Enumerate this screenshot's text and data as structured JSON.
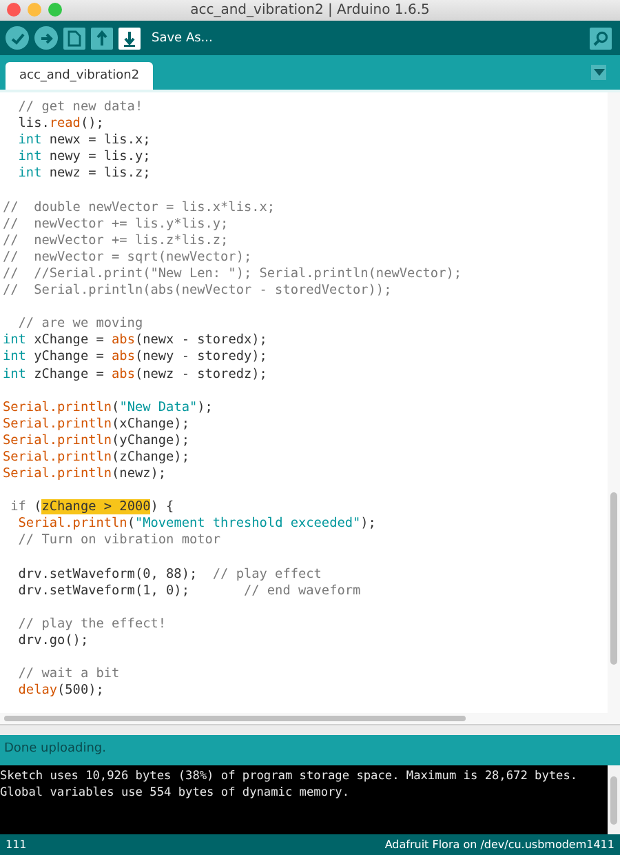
{
  "window": {
    "title": "acc_and_vibration2 | Arduino 1.6.5"
  },
  "toolbar": {
    "buttons": [
      {
        "kind": "verify",
        "highlighted": false
      },
      {
        "kind": "upload",
        "highlighted": false
      },
      {
        "kind": "new",
        "highlighted": false
      },
      {
        "kind": "open",
        "highlighted": false
      },
      {
        "kind": "save",
        "highlighted": true
      }
    ],
    "hint": "Save As..."
  },
  "tabs": [
    {
      "label": "acc_and_vibration2",
      "selected": true
    }
  ],
  "editor": {
    "lines": [
      {
        "kind": "code",
        "tokens": [
          {
            "kind": "comment",
            "text": "  // get new data!"
          }
        ]
      },
      {
        "kind": "code",
        "tokens": [
          {
            "kind": "plain",
            "text": "  lis."
          },
          {
            "kind": "function",
            "text": "read"
          },
          {
            "kind": "plain",
            "text": "();"
          }
        ]
      },
      {
        "kind": "code",
        "tokens": [
          {
            "kind": "keyword",
            "text": "  int"
          },
          {
            "kind": "plain",
            "text": " newx = lis.x;"
          }
        ]
      },
      {
        "kind": "code",
        "tokens": [
          {
            "kind": "keyword",
            "text": "  int"
          },
          {
            "kind": "plain",
            "text": " newy = lis.y;"
          }
        ]
      },
      {
        "kind": "code",
        "tokens": [
          {
            "kind": "keyword",
            "text": "  int"
          },
          {
            "kind": "plain",
            "text": " newz = lis.z;"
          }
        ]
      },
      {
        "kind": "blank"
      },
      {
        "kind": "code",
        "tokens": [
          {
            "kind": "comment",
            "text": "//  double newVector = lis.x*lis.x;"
          }
        ]
      },
      {
        "kind": "code",
        "tokens": [
          {
            "kind": "comment",
            "text": "//  newVector += lis.y*lis.y;"
          }
        ]
      },
      {
        "kind": "code",
        "tokens": [
          {
            "kind": "comment",
            "text": "//  newVector += lis.z*lis.z;"
          }
        ]
      },
      {
        "kind": "code",
        "tokens": [
          {
            "kind": "comment",
            "text": "//  newVector = sqrt(newVector);"
          }
        ]
      },
      {
        "kind": "code",
        "tokens": [
          {
            "kind": "comment",
            "text": "//  //Serial.print(\"New Len: \"); Serial.println(newVector);"
          }
        ]
      },
      {
        "kind": "code",
        "tokens": [
          {
            "kind": "comment",
            "text": "//  Serial.println(abs(newVector - storedVector));"
          }
        ]
      },
      {
        "kind": "blank"
      },
      {
        "kind": "code",
        "tokens": [
          {
            "kind": "comment",
            "text": "  // are we moving"
          }
        ]
      },
      {
        "kind": "code",
        "tokens": [
          {
            "kind": "keyword",
            "text": "int"
          },
          {
            "kind": "plain",
            "text": " xChange = "
          },
          {
            "kind": "function",
            "text": "abs"
          },
          {
            "kind": "plain",
            "text": "(newx - storedx);"
          }
        ]
      },
      {
        "kind": "code",
        "tokens": [
          {
            "kind": "keyword",
            "text": "int"
          },
          {
            "kind": "plain",
            "text": " yChange = "
          },
          {
            "kind": "function",
            "text": "abs"
          },
          {
            "kind": "plain",
            "text": "(newy - storedy);"
          }
        ]
      },
      {
        "kind": "code",
        "tokens": [
          {
            "kind": "keyword",
            "text": "int"
          },
          {
            "kind": "plain",
            "text": " zChange = "
          },
          {
            "kind": "function",
            "text": "abs"
          },
          {
            "kind": "plain",
            "text": "(newz - storedz);"
          }
        ]
      },
      {
        "kind": "blank"
      },
      {
        "kind": "code",
        "tokens": [
          {
            "kind": "function",
            "text": "Serial.println"
          },
          {
            "kind": "plain",
            "text": "("
          },
          {
            "kind": "string",
            "text": "\"New Data\""
          },
          {
            "kind": "plain",
            "text": ");"
          }
        ]
      },
      {
        "kind": "code",
        "tokens": [
          {
            "kind": "function",
            "text": "Serial.println"
          },
          {
            "kind": "plain",
            "text": "(xChange);"
          }
        ]
      },
      {
        "kind": "code",
        "tokens": [
          {
            "kind": "function",
            "text": "Serial.println"
          },
          {
            "kind": "plain",
            "text": "(yChange);"
          }
        ]
      },
      {
        "kind": "code",
        "tokens": [
          {
            "kind": "function",
            "text": "Serial.println"
          },
          {
            "kind": "plain",
            "text": "(zChange);"
          }
        ]
      },
      {
        "kind": "code",
        "tokens": [
          {
            "kind": "function",
            "text": "Serial.println"
          },
          {
            "kind": "plain",
            "text": "(newz);"
          }
        ]
      },
      {
        "kind": "blank"
      },
      {
        "kind": "code",
        "tokens": [
          {
            "kind": "comment",
            "text": " if "
          },
          {
            "kind": "plain",
            "text": "("
          },
          {
            "kind": "highlight",
            "text": "zChange > 2000"
          },
          {
            "kind": "plain",
            "text": ") {"
          }
        ]
      },
      {
        "kind": "code",
        "tokens": [
          {
            "kind": "function",
            "text": "  Serial.println"
          },
          {
            "kind": "plain",
            "text": "("
          },
          {
            "kind": "string",
            "text": "\"Movement threshold exceeded\""
          },
          {
            "kind": "plain",
            "text": ");"
          }
        ]
      },
      {
        "kind": "code",
        "tokens": [
          {
            "kind": "comment",
            "text": "  // Turn on vibration motor"
          }
        ]
      },
      {
        "kind": "blank"
      },
      {
        "kind": "code",
        "tokens": [
          {
            "kind": "plain",
            "text": "  drv.setWaveform(0, 88);  "
          },
          {
            "kind": "comment",
            "text": "// play effect"
          }
        ]
      },
      {
        "kind": "code",
        "tokens": [
          {
            "kind": "plain",
            "text": "  drv.setWaveform(1, 0);       "
          },
          {
            "kind": "comment",
            "text": "// end waveform"
          }
        ]
      },
      {
        "kind": "blank"
      },
      {
        "kind": "code",
        "tokens": [
          {
            "kind": "comment",
            "text": "  // play the effect!"
          }
        ]
      },
      {
        "kind": "code",
        "tokens": [
          {
            "kind": "plain",
            "text": "  drv.go();"
          }
        ]
      },
      {
        "kind": "blank"
      },
      {
        "kind": "code",
        "tokens": [
          {
            "kind": "comment",
            "text": "  // wait a bit"
          }
        ]
      },
      {
        "kind": "code",
        "tokens": [
          {
            "kind": "function",
            "text": "  delay"
          },
          {
            "kind": "plain",
            "text": "(500);"
          }
        ]
      }
    ]
  },
  "status": "Done uploading.",
  "console": {
    "lines": [
      "Sketch uses 10,926 bytes (38%) of program storage space. Maximum is 28,672 bytes.",
      "Global variables use 554 bytes of dynamic memory."
    ]
  },
  "status_bar": {
    "line": "111",
    "board": "Adafruit Flora on /dev/cu.usbmodem1411"
  }
}
